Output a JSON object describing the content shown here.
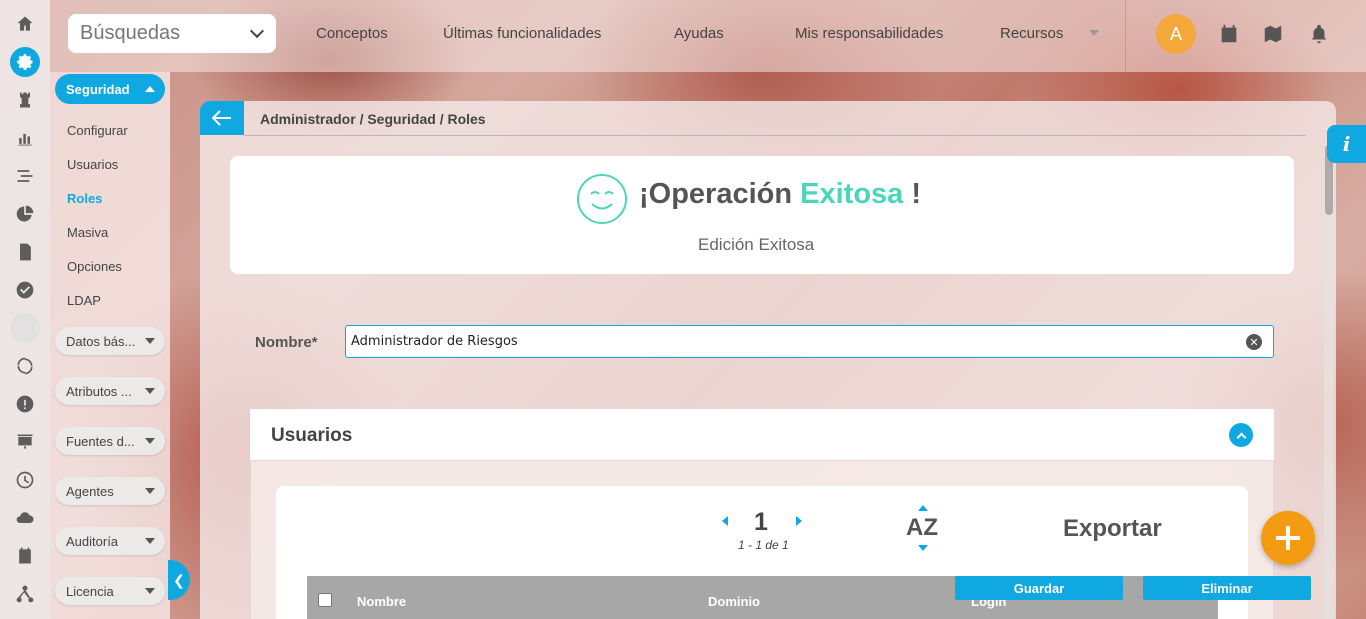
{
  "topbar": {
    "search_placeholder": "Búsquedas",
    "nav": [
      "Conceptos",
      "Últimas funcionalidades",
      "Ayudas",
      "Mis responsabilidades",
      "Recursos"
    ],
    "avatar_letter": "A"
  },
  "sidebar": {
    "section": "Seguridad",
    "items": [
      "Configurar",
      "Usuarios",
      "Roles",
      "Masiva",
      "Opciones",
      "LDAP"
    ],
    "selected": "Roles",
    "groups": [
      "Datos bás...",
      "Atributos ...",
      "Fuentes d...",
      "Agentes",
      "Auditoría",
      "Licencia"
    ]
  },
  "breadcrumb": "Administrador / Seguridad / Roles",
  "success": {
    "title_prefix": "¡Operación",
    "title_highlight": "Exitosa",
    "title_suffix": "!",
    "subtitle": "Edición Exitosa",
    "highlight_color": "#4cd6b8"
  },
  "form": {
    "name_label": "Nombre*",
    "name_value": "Administrador de Riesgos"
  },
  "users": {
    "title": "Usuarios",
    "page": "1",
    "range": "1 - 1 de 1",
    "sort_label": "AZ",
    "export_label": "Exportar",
    "columns": [
      "Nombre",
      "Dominio",
      "Login"
    ]
  },
  "actions": {
    "save": "Guardar",
    "delete": "Eliminar"
  },
  "info_label": "i",
  "accent_color": "#10a8e0",
  "fab_color": "#f39c12"
}
